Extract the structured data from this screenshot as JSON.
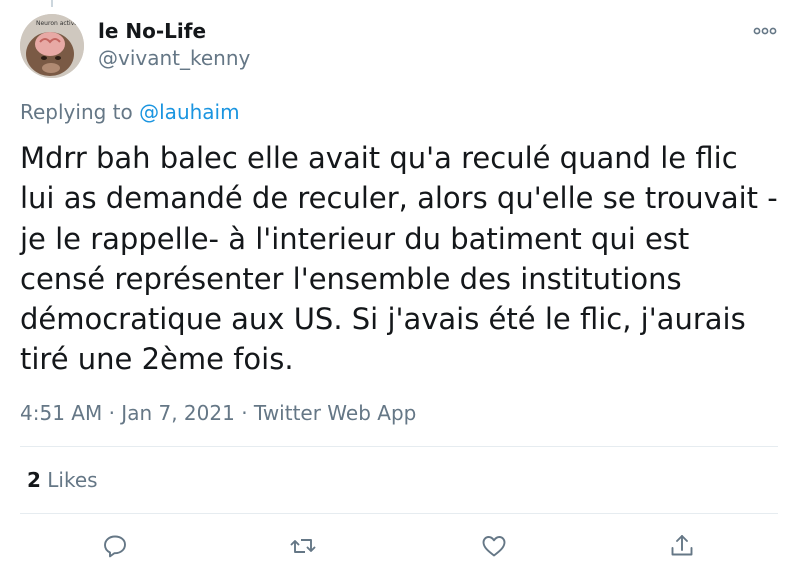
{
  "tweet": {
    "author": {
      "display_name": "le No-Life",
      "handle": "@vivant_kenny",
      "avatar_caption": "Neuron activat"
    },
    "reply_prefix": "Replying to",
    "reply_to": "@lauhaim",
    "text": "Mdrr bah balec elle avait qu'a reculé quand le flic lui as demandé de reculer, alors qu'elle se trouvait -je le rappelle- à l'interieur du batiment qui est censé représenter l'ensemble des institutions démocratique aux US. Si j'avais été le flic, j'aurais tiré une 2ème fois.",
    "time": "4:51 AM",
    "separator": "·",
    "date": "Jan 7, 2021",
    "source": "Twitter Web App",
    "likes_count": "2",
    "likes_label": "Likes"
  },
  "icons": {
    "more": "more-icon",
    "reply": "reply-icon",
    "retweet": "retweet-icon",
    "like": "heart-icon",
    "share": "share-icon"
  },
  "colors": {
    "text": "#14171a",
    "secondary": "#657786",
    "link": "#1b95e0",
    "divider": "#e6ecf0"
  }
}
